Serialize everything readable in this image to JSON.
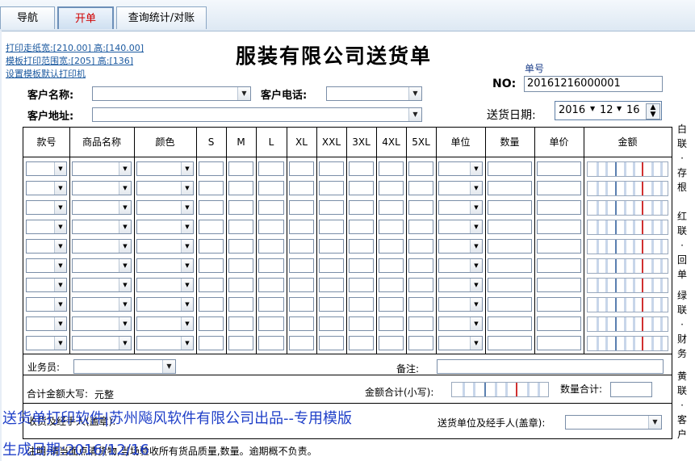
{
  "tabs": [
    {
      "label": "导航"
    },
    {
      "label": "开单"
    },
    {
      "label": "查询统计/对账"
    }
  ],
  "print_links": {
    "paper": "打印走纸宽:[210.00] 高:[140.00]",
    "range": "模板打印范围宽:[205] 高:[136]",
    "printer": "设置模板默认打印机"
  },
  "title": "服装有限公司送货单",
  "order": {
    "no_caption": "单号",
    "no_label": "NO:",
    "no_value": "20161216000001",
    "date_label": "送货日期:",
    "year": "2016",
    "month": "12",
    "day": "16"
  },
  "customer": {
    "name_label": "客户名称:",
    "phone_label": "客户电话:",
    "address_label": "客户地址:"
  },
  "table": {
    "headers": [
      "款号",
      "商品名称",
      "颜色",
      "S",
      "M",
      "L",
      "XL",
      "XXL",
      "3XL",
      "4XL",
      "5XL",
      "单位",
      "数量",
      "单价",
      "金额"
    ],
    "row_count": 10
  },
  "footer": {
    "salesman_label": "业务员:",
    "remark_label": "备注:",
    "amount_words_label": "合计金额大写:",
    "amount_words_value": "元整",
    "amount_total_label": "金额合计(小写):",
    "qty_total_label": "数量合计:",
    "receiver_label": "收货及经手人(盖章):",
    "sender_label": "送货单位及经手人(盖章):",
    "note": "注明:请当面点清货物,当场验收所有货品质量,数量。逾期概不负责。"
  },
  "copies": [
    "白联:存根",
    "红联:回单",
    "绿联:财务",
    "黄联:客户"
  ],
  "watermark": {
    "line1": "送货单打印软件|苏州飚风软件有限公司出品--专用模版",
    "line2": "生成日期:2016/12/16"
  }
}
